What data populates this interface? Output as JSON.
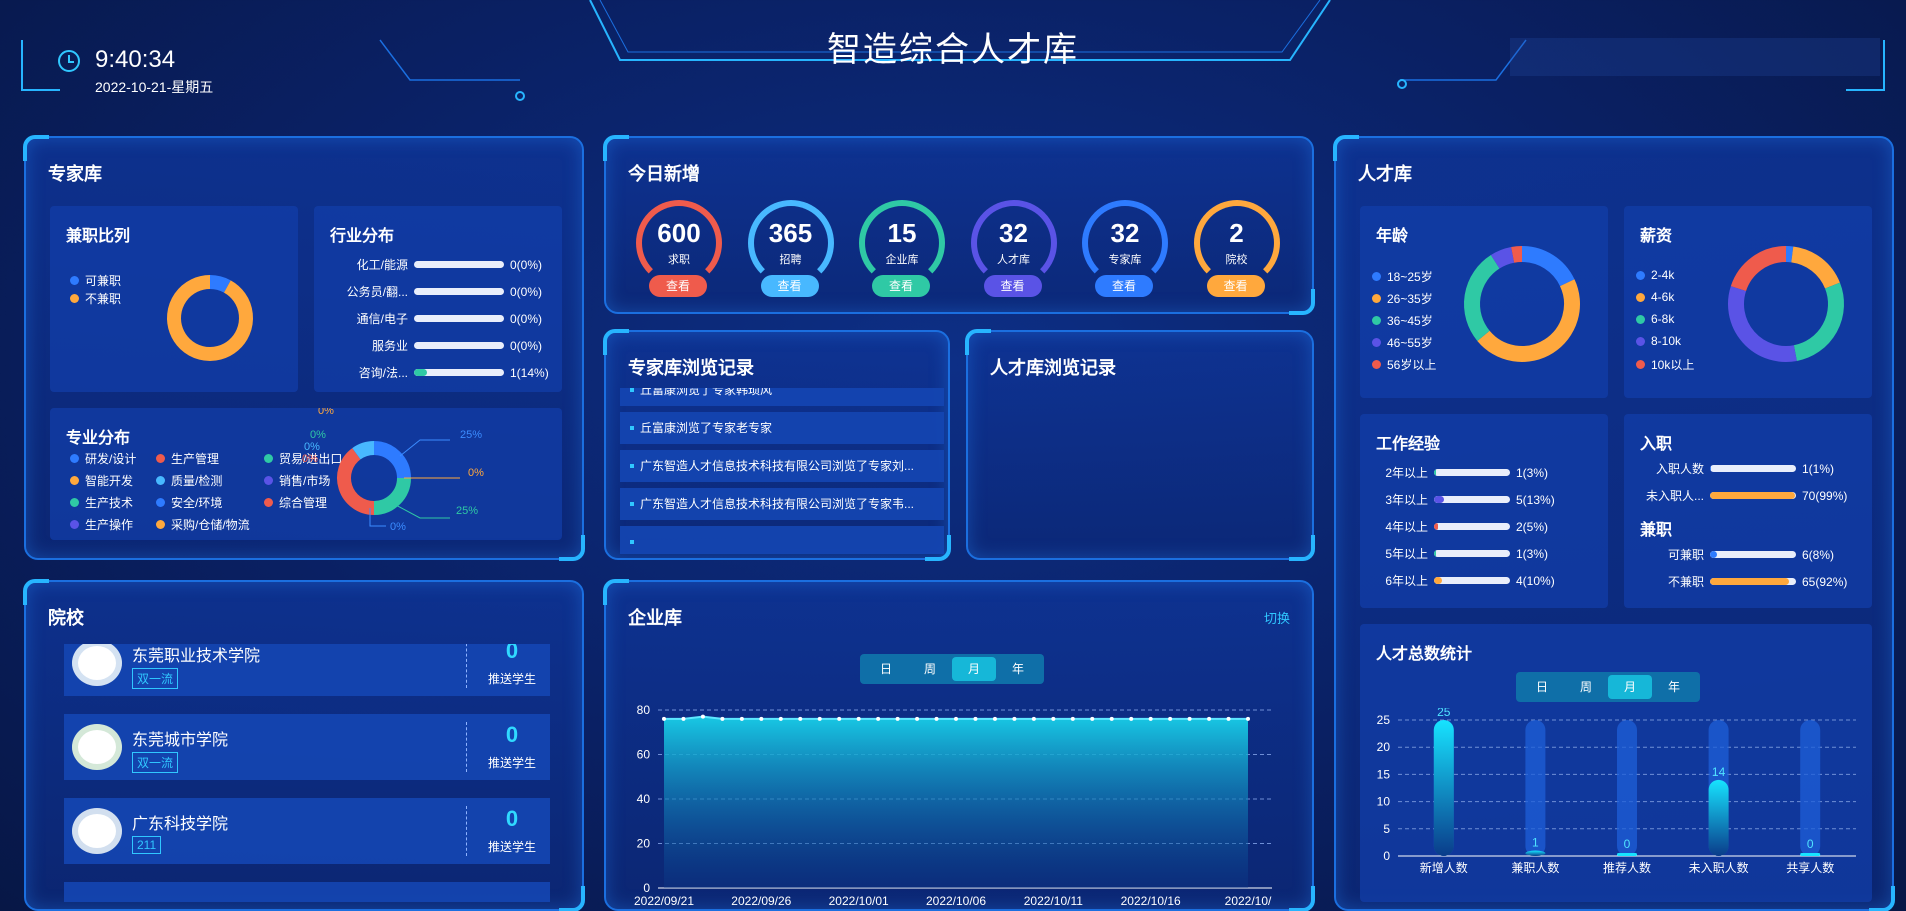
{
  "header": {
    "title": "智造综合人才库",
    "time": "9:40:34",
    "date": "2022-10-21-星期五"
  },
  "colors": {
    "blue": "#2e7bff",
    "orange": "#ffa83d",
    "teal": "#2fc9a5",
    "purple": "#5a53e6",
    "red": "#ef5b4c",
    "skyblue": "#48b8ff",
    "cyan": "#16c6e0"
  },
  "experts": {
    "title": "专家库",
    "parttime": {
      "title": "兼职比列",
      "legend": [
        "可兼职",
        "不兼职"
      ],
      "values": [
        8,
        92
      ]
    },
    "industry": {
      "title": "行业分布",
      "rows": [
        {
          "label": "化工/能源",
          "value": "0(0%)",
          "pct": 0
        },
        {
          "label": "公务员/翻...",
          "value": "0(0%)",
          "pct": 0
        },
        {
          "label": "通信/电子",
          "value": "0(0%)",
          "pct": 0
        },
        {
          "label": "服务业",
          "value": "0(0%)",
          "pct": 0
        },
        {
          "label": "咨询/法...",
          "value": "1(14%)",
          "pct": 14
        }
      ]
    },
    "major": {
      "title": "专业分布",
      "legend": [
        {
          "label": "研发/设计",
          "color": "#2e7bff"
        },
        {
          "label": "生产管理",
          "color": "#ef5b4c"
        },
        {
          "label": "贸易/进出口",
          "color": "#2fc9a5"
        },
        {
          "label": "智能开发",
          "color": "#ffa83d"
        },
        {
          "label": "质量/检测",
          "color": "#48b8ff"
        },
        {
          "label": "销售/市场",
          "color": "#5a53e6"
        },
        {
          "label": "生产技术",
          "color": "#2fc9a5"
        },
        {
          "label": "安全/环境",
          "color": "#2e7bff"
        },
        {
          "label": "综合管理",
          "color": "#ef5b4c"
        },
        {
          "label": "生产操作",
          "color": "#5a53e6"
        },
        {
          "label": "采购/仓储/物流",
          "color": "#ffa83d"
        }
      ],
      "pie_labels": [
        "25%",
        "0%",
        "25%",
        "0%",
        "0%",
        "0%",
        "0%",
        "0%"
      ]
    }
  },
  "today": {
    "title": "今日新增",
    "items": [
      {
        "value": "600",
        "label": "求职",
        "btn": "查看",
        "color": "#ef5b4c"
      },
      {
        "value": "365",
        "label": "招聘",
        "btn": "查看",
        "color": "#48b8ff"
      },
      {
        "value": "15",
        "label": "企业库",
        "btn": "查看",
        "color": "#2fc9a5"
      },
      {
        "value": "32",
        "label": "人才库",
        "btn": "查看",
        "color": "#5a53e6"
      },
      {
        "value": "32",
        "label": "专家库",
        "btn": "查看",
        "color": "#2e7bff"
      },
      {
        "value": "2",
        "label": "院校",
        "btn": "查看",
        "color": "#ffa83d"
      }
    ]
  },
  "expert_records": {
    "title": "专家库浏览记录",
    "rows": [
      "丘富康浏览了专家韩琐风",
      "丘富康浏览了专家老专家",
      "广东智造人才信息技术科技有限公司浏览了专家刘...",
      "广东智造人才信息技术科技有限公司浏览了专家韦..."
    ]
  },
  "talent_records": {
    "title": "人才库浏览记录"
  },
  "talent": {
    "title": "人才库",
    "age": {
      "title": "年龄",
      "legend": [
        "18~25岁",
        "26~35岁",
        "36~45岁",
        "46~55岁",
        "56岁以上"
      ],
      "values": [
        18,
        46,
        27,
        6,
        3
      ]
    },
    "salary": {
      "title": "薪资",
      "legend": [
        "2-4k",
        "4-6k",
        "6-8k",
        "8-10k",
        "10k以上"
      ],
      "values": [
        2,
        17,
        28,
        33,
        20
      ]
    },
    "experience": {
      "title": "工作经验",
      "rows": [
        {
          "label": "2年以上",
          "value": "1(3%)",
          "pct": 3,
          "color": "#2fc9a5"
        },
        {
          "label": "3年以上",
          "value": "5(13%)",
          "pct": 13,
          "color": "#5a53e6"
        },
        {
          "label": "4年以上",
          "value": "2(5%)",
          "pct": 5,
          "color": "#ef5b4c"
        },
        {
          "label": "5年以上",
          "value": "1(3%)",
          "pct": 3,
          "color": "#2fc9a5"
        },
        {
          "label": "6年以上",
          "value": "4(10%)",
          "pct": 10,
          "color": "#ffa83d"
        }
      ]
    },
    "jobs": {
      "title": "入职",
      "rows": [
        {
          "label": "入职人数",
          "value": "1(1%)",
          "pct": 1,
          "color": "#2e7bff"
        },
        {
          "label": "未入职人...",
          "value": "70(99%)",
          "pct": 99,
          "color": "#ffa83d"
        }
      ],
      "title2": "兼职",
      "rows2": [
        {
          "label": "可兼职",
          "value": "6(8%)",
          "pct": 8,
          "color": "#2e7bff"
        },
        {
          "label": "不兼职",
          "value": "65(92%)",
          "pct": 92,
          "color": "#ffa83d"
        }
      ]
    },
    "total": {
      "title": "人才总数统计",
      "tabs": [
        "日",
        "周",
        "月",
        "年"
      ],
      "active_tab": "月"
    }
  },
  "schools": {
    "title": "院校",
    "rows": [
      {
        "name": "东莞职业技术学院",
        "tag": "双一流",
        "count": "0",
        "sub": "推送学生"
      },
      {
        "name": "东莞城市学院",
        "tag": "双一流",
        "count": "0",
        "sub": "推送学生"
      },
      {
        "name": "广东科技学院",
        "tag": "211",
        "count": "0",
        "sub": "推送学生"
      }
    ]
  },
  "enterprise": {
    "title": "企业库",
    "switch_label": "切换",
    "tabs": [
      "日",
      "周",
      "月",
      "年"
    ],
    "active_tab": "月"
  },
  "chart_data": [
    {
      "type": "area",
      "x": [
        "2022/09/21",
        "2022/09/22",
        "2022/09/23",
        "2022/09/24",
        "2022/09/25",
        "2022/09/26",
        "2022/09/27",
        "2022/09/28",
        "2022/09/29",
        "2022/09/30",
        "2022/10/01",
        "2022/10/02",
        "2022/10/03",
        "2022/10/04",
        "2022/10/05",
        "2022/10/06",
        "2022/10/07",
        "2022/10/08",
        "2022/10/09",
        "2022/10/10",
        "2022/10/11",
        "2022/10/12",
        "2022/10/13",
        "2022/10/14",
        "2022/10/15",
        "2022/10/16",
        "2022/10/17",
        "2022/10/18",
        "2022/10/19",
        "2022/10/20",
        "2022/10/21"
      ],
      "x_tick_labels": [
        "2022/09/21",
        "2022/09/26",
        "2022/10/01",
        "2022/10/06",
        "2022/10/11",
        "2022/10/16",
        "2022/10/"
      ],
      "series": [
        {
          "values": [
            76,
            76,
            77,
            76,
            76,
            76,
            76,
            76,
            76,
            76,
            76,
            76,
            76,
            76,
            76,
            76,
            76,
            76,
            76,
            76,
            76,
            76,
            76,
            76,
            76,
            76,
            76,
            76,
            76,
            76,
            76
          ]
        }
      ],
      "ylim": [
        0,
        80
      ],
      "yticks": [
        0,
        20,
        40,
        60,
        80
      ],
      "grid": true
    },
    {
      "type": "bar",
      "categories": [
        "新增人数",
        "兼职人数",
        "推荐人数",
        "未入职人数",
        "共享人数"
      ],
      "values": [
        25,
        1,
        0,
        14,
        0
      ],
      "value_labels": [
        "25",
        "1",
        "0",
        "14",
        "0"
      ],
      "ylim": [
        0,
        25
      ],
      "yticks": [
        0,
        5,
        10,
        15,
        20,
        25
      ],
      "grid": true
    }
  ]
}
